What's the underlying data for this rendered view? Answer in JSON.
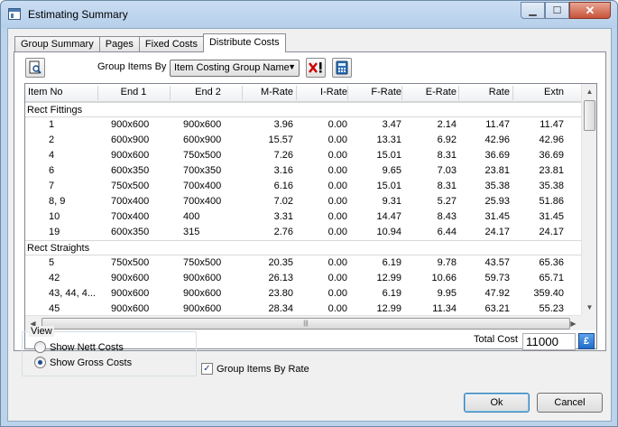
{
  "window": {
    "title": "Estimating Summary",
    "minimize_glyph": "▁",
    "maximize_glyph": "☐",
    "close_glyph": "✕"
  },
  "tabs": [
    {
      "label": "Group Summary",
      "active": false
    },
    {
      "label": "Pages",
      "active": false
    },
    {
      "label": "Fixed Costs",
      "active": false
    },
    {
      "label": "Distribute Costs",
      "active": true
    }
  ],
  "toolbar": {
    "preview_icon": "print-preview-icon",
    "group_items_by_label": "Group Items By",
    "group_items_by_value": "Item Costing Group Name",
    "clear_icon": "clear-x-icon",
    "calculator_icon": "calculator-icon"
  },
  "grid": {
    "columns": [
      "Item No",
      "End 1",
      "End 2",
      "M-Rate",
      "I-Rate",
      "F-Rate",
      "E-Rate",
      "Rate",
      "Extn"
    ],
    "groups": [
      {
        "name": "Rect Fittings",
        "rows": [
          [
            "1",
            "900x600",
            "900x600",
            "3.96",
            "0.00",
            "3.47",
            "2.14",
            "11.47",
            "11.47"
          ],
          [
            "2",
            "600x900",
            "600x900",
            "15.57",
            "0.00",
            "13.31",
            "6.92",
            "42.96",
            "42.96"
          ],
          [
            "4",
            "900x600",
            "750x500",
            "7.26",
            "0.00",
            "15.01",
            "8.31",
            "36.69",
            "36.69"
          ],
          [
            "6",
            "600x350",
            "700x350",
            "3.16",
            "0.00",
            "9.65",
            "7.03",
            "23.81",
            "23.81"
          ],
          [
            "7",
            "750x500",
            "700x400",
            "6.16",
            "0.00",
            "15.01",
            "8.31",
            "35.38",
            "35.38"
          ],
          [
            "8, 9",
            "700x400",
            "700x400",
            "7.02",
            "0.00",
            "9.31",
            "5.27",
            "25.93",
            "51.86"
          ],
          [
            "10",
            "700x400",
            "400",
            "3.31",
            "0.00",
            "14.47",
            "8.43",
            "31.45",
            "31.45"
          ],
          [
            "19",
            "600x350",
            "315",
            "2.76",
            "0.00",
            "10.94",
            "6.44",
            "24.17",
            "24.17"
          ]
        ]
      },
      {
        "name": "Rect Straights",
        "rows": [
          [
            "5",
            "750x500",
            "750x500",
            "20.35",
            "0.00",
            "6.19",
            "9.78",
            "43.57",
            "65.36"
          ],
          [
            "42",
            "900x600",
            "900x600",
            "26.13",
            "0.00",
            "12.99",
            "10.66",
            "59.73",
            "65.71"
          ],
          [
            "43, 44, 4...",
            "900x600",
            "900x600",
            "23.80",
            "0.00",
            "6.19",
            "9.95",
            "47.92",
            "359.40"
          ],
          [
            "45",
            "900x600",
            "900x600",
            "28.34",
            "0.00",
            "12.99",
            "11.34",
            "63.21",
            "55.23"
          ]
        ]
      }
    ]
  },
  "view": {
    "legend": "View",
    "options": [
      {
        "label": "Show Nett Costs",
        "checked": false
      },
      {
        "label": "Show Gross Costs",
        "checked": true
      }
    ]
  },
  "group_by_rate": {
    "label": "Group Items By Rate",
    "checked": true
  },
  "total_cost": {
    "label": "Total Cost",
    "value": "11000",
    "currency_symbol": "£"
  },
  "buttons": {
    "ok": "Ok",
    "cancel": "Cancel"
  }
}
